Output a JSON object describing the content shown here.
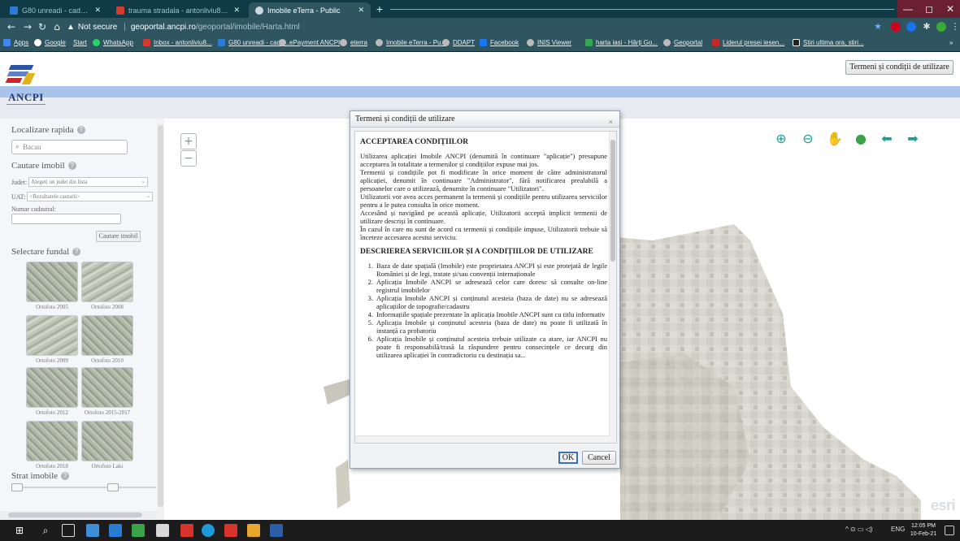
{
  "browser": {
    "tabs": [
      {
        "title": "G80 unreadi - cadastru_experti..."
      },
      {
        "title": "trauma stradala - antonliviu85@..."
      },
      {
        "title": "Imobile eTerra - Public"
      }
    ],
    "window_controls": {
      "minimize": "—",
      "maximize": "◻",
      "close": "✕"
    },
    "address": {
      "security_label": "Not secure",
      "domain": "geoportal.ancpi.ro",
      "path": "/geoportal/imobile/Harta.html"
    },
    "bookmarks": [
      {
        "label": "Apps"
      },
      {
        "label": "Google"
      },
      {
        "label": "Start"
      },
      {
        "label": "WhatsApp"
      },
      {
        "label": "Inbox - antonliviu8..."
      },
      {
        "label": "G80 unreadi - cada..."
      },
      {
        "label": "ePayment ANCPI"
      },
      {
        "label": "eterra"
      },
      {
        "label": "Imobile eTerra - Pu..."
      },
      {
        "label": "DDAPT"
      },
      {
        "label": "Facebook"
      },
      {
        "label": "INIS Viewer"
      },
      {
        "label": "harta iasi - Hărți Go..."
      },
      {
        "label": "Geoportal"
      },
      {
        "label": "Liderul presei iesen..."
      },
      {
        "label": "Stiri ultima ora, stiri..."
      }
    ],
    "bookmarks_overflow": "»"
  },
  "site": {
    "logo_text": "ANCPI",
    "terms_button": "Termeni și condiții de utilizare"
  },
  "left_panel": {
    "quick_locate_title": "Localizare rapida",
    "search_placeholder": "Bacau",
    "property_search_title": "Cautare imobil",
    "county_label": "Judet:",
    "county_placeholder": "Alegeti un judet din lista",
    "uat_label": "UAT:",
    "uat_placeholder": "<Rezultatele cautarii>",
    "cadastral_label": "Numar cadastral:",
    "search_button": "Cautare imobil",
    "background_title": "Selectare fundal",
    "backgrounds": [
      {
        "label": "Ortofoto 2005"
      },
      {
        "label": "Ortofoto 2008"
      },
      {
        "label": "Ortofoto 2009"
      },
      {
        "label": "Ortofoto 2010"
      },
      {
        "label": "Ortofoto 2012"
      },
      {
        "label": "Ortofoto 2015-2017"
      },
      {
        "label": "Ortofoto 2018"
      },
      {
        "label": "Ortofoto Lakı"
      }
    ],
    "layer_title": "Strat imobile"
  },
  "map": {
    "zoom_in": "+",
    "zoom_out": "−",
    "watermark": "esri"
  },
  "dialog": {
    "title": "Termeni și condiții de utilizare",
    "close": "×",
    "heading1": "ACCEPTAREA CONDIȚIILOR",
    "paragraph1": "Utilizarea aplicației Imobile ANCPI (denumită în continuare \"aplicație\") presupune acceptarea în totalitate a termenilor și condițiilor expuse mai jos.",
    "paragraph2": "Termenii și condițiile pot fi modificate în orice moment de către administratorul aplicației, denumit în continuare \"Administrator\", fără notificarea prealabilă a persoanelor care o utilizează, denumite în continuare \"Utilizatori\".",
    "paragraph3": "Utilizatorii vor avea acces permanent la termenii și condițiile pentru utilizarea serviciilor pentru a le putea consulta în orice moment.",
    "paragraph4": "Accesând și navigând pe această aplicație, Utilizatorii acceptă implicit termenii de utilizare descriși în continuare.",
    "paragraph5": "În cazul în care nu sunt de acord cu termenii și condițiile impuse, Utilizatorii trebuie să înceteze accesarea acestui serviciu.",
    "heading2": "DESCRIEREA SERVICIILOR ȘI A CONDIȚIILOR DE UTILIZARE",
    "items": [
      {
        "num": "1.",
        "text": "Baza de date spațială (Imobile) este proprietatea ANCPI și este protejată de legile României și de legi, tratate și/sau convenții internaționale"
      },
      {
        "num": "2.",
        "text": "Aplicația Imobile ANCPI se adresează celor care doresc să consulte on-line registrul imobilelor"
      },
      {
        "num": "3.",
        "text": "Aplicația Imobile ANCPI și conținutul acesteia (baza de date) nu se adresează aplicațiilor de topografie/cadastru"
      },
      {
        "num": "4.",
        "text": "Informațiile spațiale prezentate în aplicația Imobile ANCPI sunt cu titlu informativ"
      },
      {
        "num": "5.",
        "text": "Aplicația Imobile și conținutul acesteia (baza de date) nu poate fi utilizată în instanță ca probatoriu"
      },
      {
        "num": "6.",
        "text": "Aplicația Imobile și conținutul acesteia trebuie utilizate ca atare, iar ANCPI nu poate fi responsabilă/trasă la răspundere pentru consecințele ce decurg din utilizarea aplicației în contradictoriu cu destinația sa..."
      }
    ],
    "ok": "OK",
    "cancel": "Cancel"
  },
  "taskbar": {
    "language": "ENG",
    "time": "12:05 PM",
    "date": "10-Feb-21"
  }
}
